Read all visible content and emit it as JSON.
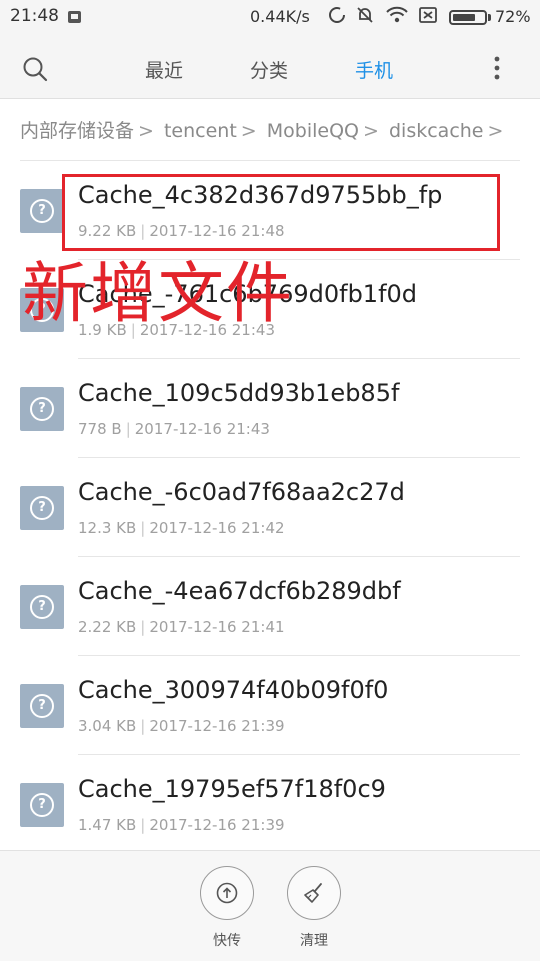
{
  "status_bar": {
    "time": "21:48",
    "net_speed": "0.44K/s",
    "battery_text": "72%",
    "battery_level": 0.72
  },
  "toolbar": {
    "tabs": [
      {
        "label": "最近",
        "active": false
      },
      {
        "label": "分类",
        "active": false
      },
      {
        "label": "手机",
        "active": true
      }
    ],
    "accent_color": "#1e90e6"
  },
  "breadcrumb": [
    "内部存储设备",
    "tencent",
    "MobileQQ",
    "diskcache"
  ],
  "files": [
    {
      "name": "Cache_4c382d367d9755bb_fp",
      "size": "9.22 KB",
      "date": "2017-12-16 21:48"
    },
    {
      "name": "Cache_-761c6b769d0fb1f0d",
      "size": "1.9 KB",
      "date": "2017-12-16 21:43"
    },
    {
      "name": "Cache_109c5dd93b1eb85f",
      "size": "778 B",
      "date": "2017-12-16 21:43"
    },
    {
      "name": "Cache_-6c0ad7f68aa2c27d",
      "size": "12.3 KB",
      "date": "2017-12-16 21:42"
    },
    {
      "name": "Cache_-4ea67dcf6b289dbf",
      "size": "2.22 KB",
      "date": "2017-12-16 21:41"
    },
    {
      "name": "Cache_300974f40b09f0f0",
      "size": "3.04 KB",
      "date": "2017-12-16 21:39"
    },
    {
      "name": "Cache_19795ef57f18f0c9",
      "size": "1.47 KB",
      "date": "2017-12-16 21:39"
    }
  ],
  "annotation": {
    "text": "新增文件",
    "color": "#e3242b"
  },
  "bottom_bar": {
    "share_label": "快传",
    "clean_label": "清理"
  },
  "icons": {
    "search": "search-icon",
    "more": "more-vertical-icon",
    "file": "unknown-file-icon",
    "share": "upload-share-icon",
    "clean": "broom-icon"
  }
}
